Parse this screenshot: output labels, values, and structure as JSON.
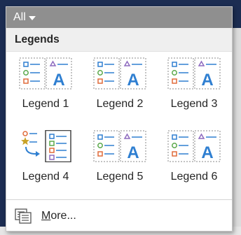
{
  "filter": {
    "label": "All"
  },
  "section": {
    "title": "Legends"
  },
  "items": [
    {
      "label": "Legend 1",
      "icon": "legend-side-icon"
    },
    {
      "label": "Legend 2",
      "icon": "legend-side-icon"
    },
    {
      "label": "Legend 3",
      "icon": "legend-side-icon"
    },
    {
      "label": "Legend 4",
      "icon": "legend-flow-icon"
    },
    {
      "label": "Legend 5",
      "icon": "legend-side-icon"
    },
    {
      "label": "Legend 6",
      "icon": "legend-side-icon"
    }
  ],
  "more": {
    "first_letter": "M",
    "rest": "ore..."
  },
  "colors": {
    "blue_symbol": "#2f7fd1",
    "green_symbol": "#5aa84a",
    "orange_symbol": "#e06b3a",
    "purple_symbol": "#8e6bbf",
    "star": "#c9a227",
    "header_bar": "#8f8f8f",
    "section_bg": "#efefef"
  }
}
